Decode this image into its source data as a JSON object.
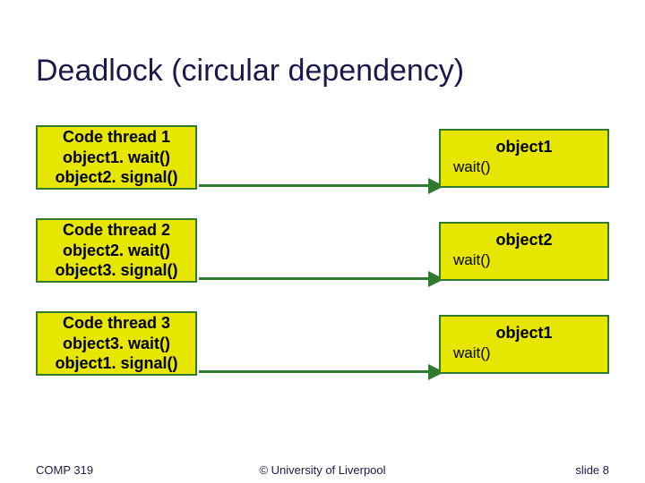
{
  "title": "Deadlock (circular dependency)",
  "rows": [
    {
      "code": {
        "head": "Code thread 1",
        "l1": "object1. wait()",
        "l2": "object2. signal()"
      },
      "obj": {
        "name": "object1",
        "wait": "wait()"
      }
    },
    {
      "code": {
        "head": "Code thread 2",
        "l1": "object2. wait()",
        "l2": "object3. signal()"
      },
      "obj": {
        "name": "object2",
        "wait": "wait()"
      }
    },
    {
      "code": {
        "head": "Code thread 3",
        "l1": "object3. wait()",
        "l2": "object1. signal()"
      },
      "obj": {
        "name": "object1",
        "wait": "wait()"
      }
    }
  ],
  "footer": {
    "course": "COMP 319",
    "copyright": "© University of Liverpool",
    "pagenum": "slide  8"
  }
}
